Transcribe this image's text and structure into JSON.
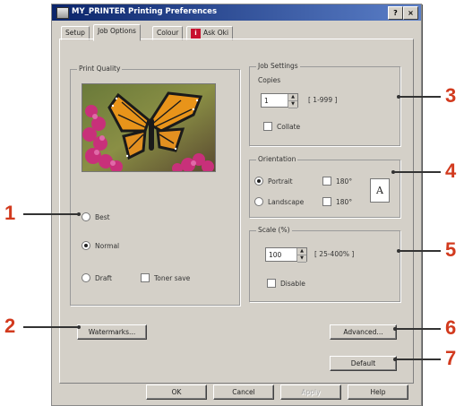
{
  "window": {
    "title": "MY_PRINTER Printing Preferences",
    "help_btn": "?",
    "close_btn": "×"
  },
  "tabs": [
    {
      "label": "Setup"
    },
    {
      "label": "Job Options"
    },
    {
      "label": "Colour"
    },
    {
      "label": "Ask Oki",
      "icon": "oki-info-icon"
    }
  ],
  "print_quality": {
    "legend": "Print Quality",
    "options": [
      {
        "label": "Best",
        "selected": false
      },
      {
        "label": "Normal",
        "selected": true
      },
      {
        "label": "Draft",
        "selected": false
      }
    ],
    "toner_save": {
      "label": "Toner save",
      "checked": false
    }
  },
  "job_settings": {
    "legend": "Job Settings",
    "copies_label": "Copies",
    "copies_value": "1",
    "copies_range": "[ 1-999 ]",
    "collate": {
      "label": "Collate",
      "checked": false
    }
  },
  "orientation": {
    "legend": "Orientation",
    "portrait": {
      "label": "Portrait",
      "selected": true
    },
    "landscape": {
      "label": "Landscape",
      "selected": false
    },
    "rotate_180a": {
      "label": "180°",
      "checked": false
    },
    "rotate_180b": {
      "label": "180°",
      "checked": false
    },
    "preview_letter": "A"
  },
  "scale": {
    "legend": "Scale (%)",
    "value": "100",
    "range": "[ 25-400% ]",
    "disable": {
      "label": "Disable",
      "checked": false
    }
  },
  "buttons": {
    "watermarks": "Watermarks...",
    "advanced": "Advanced...",
    "default": "Default",
    "ok": "OK",
    "cancel": "Cancel",
    "apply": "Apply",
    "help": "Help"
  },
  "callouts": [
    "1",
    "2",
    "3",
    "4",
    "5",
    "6",
    "7"
  ],
  "colors": {
    "callout": "#d23a1e",
    "dialog_face": "#d4d0c8",
    "title_bar_start": "#0a246a",
    "title_bar_end": "#5b7fc8",
    "oki_red": "#c8102e"
  }
}
